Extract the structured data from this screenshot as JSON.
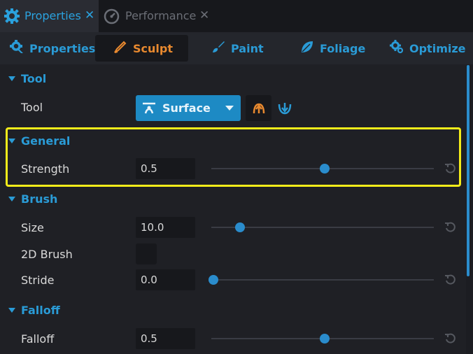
{
  "doc_tabs": [
    {
      "label": "Properties",
      "icon": "gear-icon",
      "active": true,
      "close": "✕"
    },
    {
      "label": "Performance",
      "icon": "gauge-icon",
      "active": false,
      "close": "✕"
    }
  ],
  "modes": [
    {
      "label": "Properties",
      "icon": "properties-gear-icon"
    },
    {
      "label": "Sculpt",
      "icon": "sculpt-brush-icon",
      "active": true
    },
    {
      "label": "Paint",
      "icon": "paint-brush-icon"
    },
    {
      "label": "Foliage",
      "icon": "leaf-icon"
    },
    {
      "label": "Optimize",
      "icon": "optimize-gear-icon"
    }
  ],
  "sections": {
    "tool": {
      "title": "Tool",
      "tool_label": "Tool",
      "dropdown_value": "Surface",
      "dropdown_icon": "surface-icon",
      "buttons": [
        "raise-arrow-icon",
        "lower-arrow-icon"
      ]
    },
    "general": {
      "title": "General",
      "strength": {
        "label": "Strength",
        "value": "0.5",
        "fraction": 0.5
      }
    },
    "brush": {
      "title": "Brush",
      "size": {
        "label": "Size",
        "value": "10.0",
        "fraction": 0.12
      },
      "brush2d": {
        "label": "2D Brush",
        "checked": false
      },
      "stride": {
        "label": "Stride",
        "value": "0.0",
        "fraction": 0.0
      }
    },
    "falloff": {
      "title": "Falloff",
      "falloff": {
        "label": "Falloff",
        "value": "0.5",
        "fraction": 0.5
      }
    }
  },
  "colors": {
    "accent_blue": "#2a9bd6",
    "accent_orange": "#e8892f",
    "highlight_yellow": "#f4ec1a",
    "background": "#1f2025"
  }
}
